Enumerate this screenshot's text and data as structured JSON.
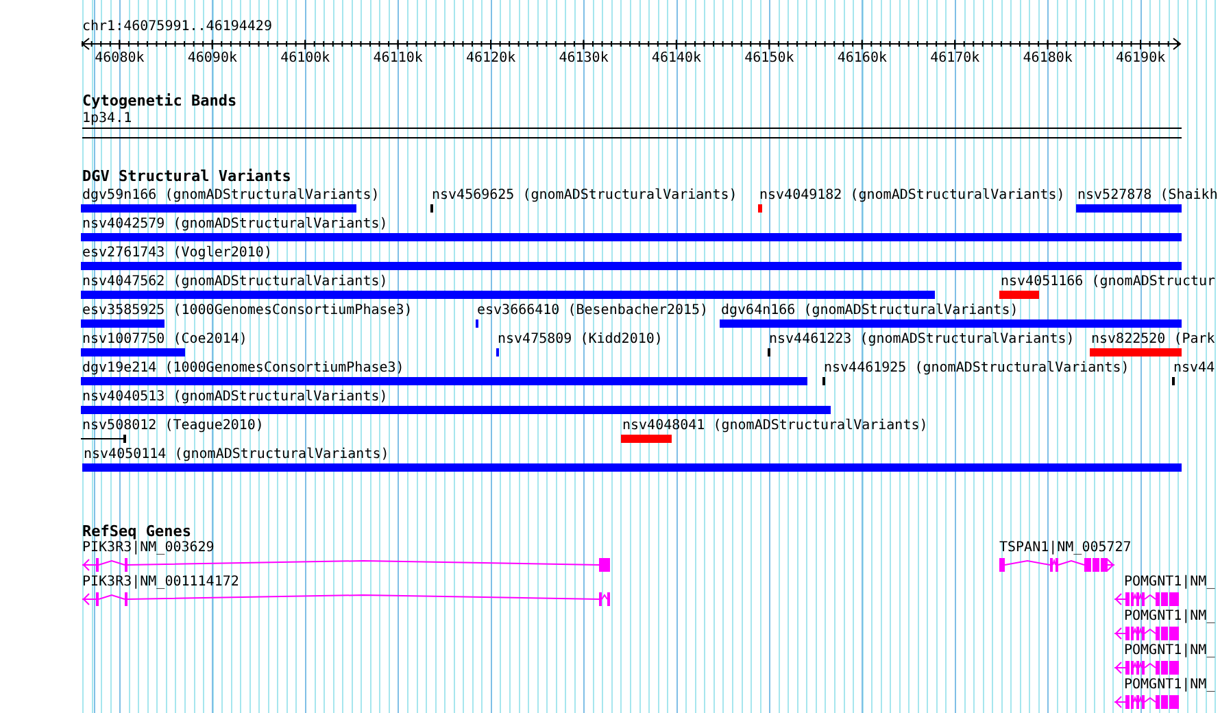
{
  "ruler": {
    "location": "chr1:46075991..46194429",
    "ticks": [
      "46080k",
      "46090k",
      "46100k",
      "46110k",
      "46120k",
      "46130k",
      "46140k",
      "46150k",
      "46160k",
      "46170k",
      "46180k",
      "46190k"
    ]
  },
  "cytogenetic_bands": {
    "title": "Cytogenetic Bands",
    "band_label": "1p34.1"
  },
  "dgv_variants": {
    "title": "DGV Structural Variants",
    "features": [
      {
        "label": "dgv59n166 (gnomADStructuralVariants)",
        "kind": "bar",
        "color": "#0000ff"
      },
      {
        "label": "nsv4569625 (gnomADStructuralVariants)",
        "kind": "bar",
        "color": "#000000"
      },
      {
        "label": "nsv4049182 (gnomADStructuralVariants)",
        "kind": "bar",
        "color": "#ff0000"
      },
      {
        "label": "nsv527878 (Shaikh",
        "kind": "bar",
        "color": "#0000ff"
      },
      {
        "label": "nsv4042579 (gnomADStructuralVariants)",
        "kind": "bar",
        "color": "#0000ff"
      },
      {
        "label": "esv2761743 (Vogler2010)",
        "kind": "bar",
        "color": "#0000ff"
      },
      {
        "label": "nsv4047562 (gnomADStructuralVariants)",
        "kind": "bar",
        "color": "#0000ff"
      },
      {
        "label": "nsv4051166 (gnomADStructur",
        "kind": "bar",
        "color": "#ff0000"
      },
      {
        "label": "esv3585925 (1000GenomesConsortiumPhase3)",
        "kind": "bar",
        "color": "#0000ff"
      },
      {
        "label": "esv3666410 (Besenbacher2015)",
        "kind": "bar",
        "color": "#0000ff"
      },
      {
        "label": "dgv64n166 (gnomADStructuralVariants)",
        "kind": "bar",
        "color": "#0000ff"
      },
      {
        "label": "nsv1007750 (Coe2014)",
        "kind": "bar",
        "color": "#0000ff"
      },
      {
        "label": "nsv475809 (Kidd2010)",
        "kind": "bar",
        "color": "#0000ff"
      },
      {
        "label": "nsv4461223 (gnomADStructuralVariants)",
        "kind": "bar",
        "color": "#000000"
      },
      {
        "label": "nsv822520 (Park",
        "kind": "bar",
        "color": "#ff0000"
      },
      {
        "label": "dgv19e214 (1000GenomesConsortiumPhase3)",
        "kind": "bar",
        "color": "#0000ff"
      },
      {
        "label": "nsv4461925 (gnomADStructuralVariants)",
        "kind": "bar",
        "color": "#000000"
      },
      {
        "label": "nsv44",
        "kind": "bar",
        "color": "#000000"
      },
      {
        "label": "nsv4040513 (gnomADStructuralVariants)",
        "kind": "bar",
        "color": "#0000ff"
      },
      {
        "label": "nsv508012 (Teague2010)",
        "kind": "line",
        "color": "#000000"
      },
      {
        "label": "nsv4048041 (gnomADStructuralVariants)",
        "kind": "bar",
        "color": "#ff0000"
      },
      {
        "label": "nsv4050114 (gnomADStructuralVariants)",
        "kind": "bar",
        "color": "#0000ff"
      }
    ]
  },
  "refseq_genes": {
    "title": "RefSeq Genes",
    "genes": [
      {
        "label": "PIK3R3|NM_003629",
        "reverse_strand": true
      },
      {
        "label": "TSPAN1|NM_005727",
        "reverse_strand": false
      },
      {
        "label": "PIK3R3|NM_001114172",
        "reverse_strand": true
      },
      {
        "label": "POMGNT1|NM_",
        "reverse_strand": true
      },
      {
        "label": "POMGNT1|NM_",
        "reverse_strand": true
      },
      {
        "label": "POMGNT1|NM_",
        "reverse_strand": true
      },
      {
        "label": "POMGNT1|NM_",
        "reverse_strand": true
      }
    ]
  }
}
